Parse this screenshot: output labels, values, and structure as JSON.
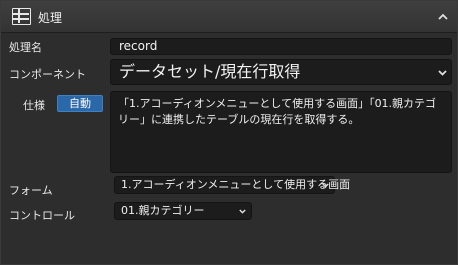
{
  "header": {
    "title": "処理",
    "icon": "grid-icon",
    "collapse_icon": "chevron-up-icon"
  },
  "fields": {
    "name": {
      "label": "処理名",
      "value": "record"
    },
    "component": {
      "label": "コンポーネント",
      "value": "データセット/現在行取得"
    },
    "spec": {
      "label": "仕様",
      "badge": "自動",
      "text": "「1.アコーディオンメニューとして使用する画面」「01.親カテゴリー」に連携したテーブルの現在行を取得する。"
    },
    "form": {
      "label": "フォーム",
      "value": "1.アコーディオンメニューとして使用する画面"
    },
    "control": {
      "label": "コントロール",
      "value": "01.親カテゴリー"
    }
  },
  "colors": {
    "background": "#2d2d2d",
    "input": "#1c1c1c",
    "accent": "#2a68a9"
  }
}
